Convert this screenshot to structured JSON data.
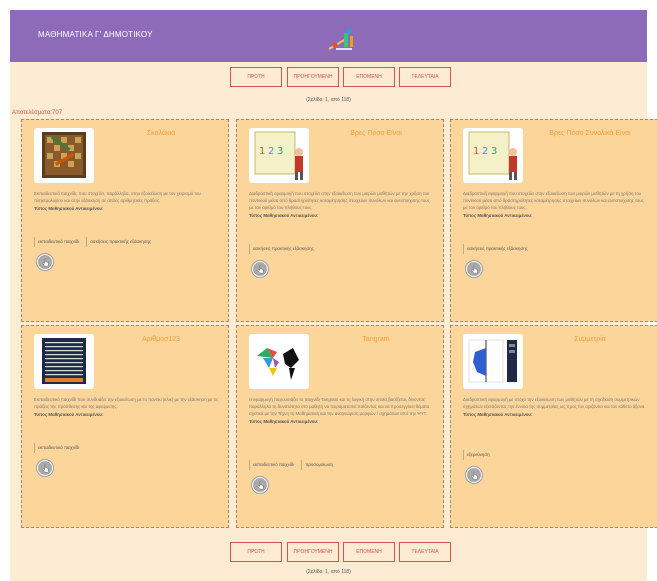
{
  "header": {
    "title": "ΜΑΘΗΜΑΤΙΚΑ Γ' ΔΗΜΟΤΙΚΟΥ",
    "logo_icon": "math-logo-icon"
  },
  "pagination": {
    "first": "ΠΡΩΤΗ",
    "previous": "ΠΡΟΗΓΟΥΜΕΝΗ",
    "next": "ΕΠΟΜΕΝΗ",
    "last": "ΤΕΛΕΥΤΑΙΑ",
    "page_info": "(Σελίδα: 1, από 118)"
  },
  "results_label": "Αποτελέσματα:707",
  "type_label": "Τύπος Μαθησιακού Αντικειμένου:",
  "cards": [
    {
      "title": "Σκαλάκια",
      "description": "Εκπαιδευτικό παιχνίδι, που στοχεύει, παράλληλα, στην εξοικείωση με τον χειρισμό του πληκτρολογίου και στην εξάσκηση σε απλές αριθμητικές πράξεις.",
      "tags": [
        "εκπαιδευτικό παιχνίδι",
        "ασκήσεις πρακτικής εξάσκησης"
      ]
    },
    {
      "title": "Βρες Πόσο Είναι",
      "description": "Διαδραστική εφαρμογή που στοχεύει στην εξοικείωση των μικρών μαθητών με την χρήση του ποντικιού μέσα από δραστηριότητες καταμέτρησης στοιχείων συνόλων και αντιστοίχισης τους με τον αριθμό του πλήθους τους.",
      "tags": [
        "ασκήσεις πρακτικής εξάσκησης"
      ]
    },
    {
      "title": "Βρες Πόσο Συνολικά Είναι",
      "description": "Διαδραστική εφαρμογή που στοχεύει στην εξοικείωση των μικρών μαθητών με τη χρήση του ποντικιού μέσα από δραστηριότητες καταμέτρησης στοιχείων συνόλων και αντιστοίχισης τους με τον αριθμό του πλήθους τους.",
      "tags": [
        "ασκήσεις πρακτικής εξάσκησης"
      ]
    },
    {
      "title": "Αριθμοσ123",
      "description": "Εκπαιδευτικό παιχνίδι που συνδυάζει την εξοικείωση με το ποντίκι (κλικ) με την εξάσκηση με τις πράξεις της πρόσθεσης και της αφαίρεσης.",
      "tags": [
        "εκπαιδευτικό παιχνίδι"
      ]
    },
    {
      "title": "Tangram",
      "description": "Η εφαρμογή παρουσιάζει το παιχνίδι Tangram και τη λογική στην οποία βασίζεται, δίνοντας παράλληλα τη δυνατότητα στο μαθητή να πειραματιστεί παίζοντας και να προσεγγίσει θέματα σχετικά με την Τέχνη τη Μαθηματική και την αναγνώριση μορφών / σχημάτων από την ΨΥΤ.",
      "tags": [
        "εκπαιδευτικό παιχνίδι",
        "προσομοίωση"
      ]
    },
    {
      "title": "Συμμετρία",
      "description": "Διαδραστική εφαρμογή με στόχο την εξοικείωση των μαθητών με τη σχεδίαση συμμετρικών σχημάτων εξετάζοντας την έννοια της συμμετρίας ως προς τον οριζόντιο και τον κάθετο άξονα.",
      "tags": [
        "εξερεύνηση"
      ]
    }
  ],
  "colors": {
    "header": "#8d6bb8",
    "page_background": "#fdebd3",
    "card_background": "#fcd59b",
    "accent_red": "#d9534f",
    "card_title": "#f39c3d"
  }
}
